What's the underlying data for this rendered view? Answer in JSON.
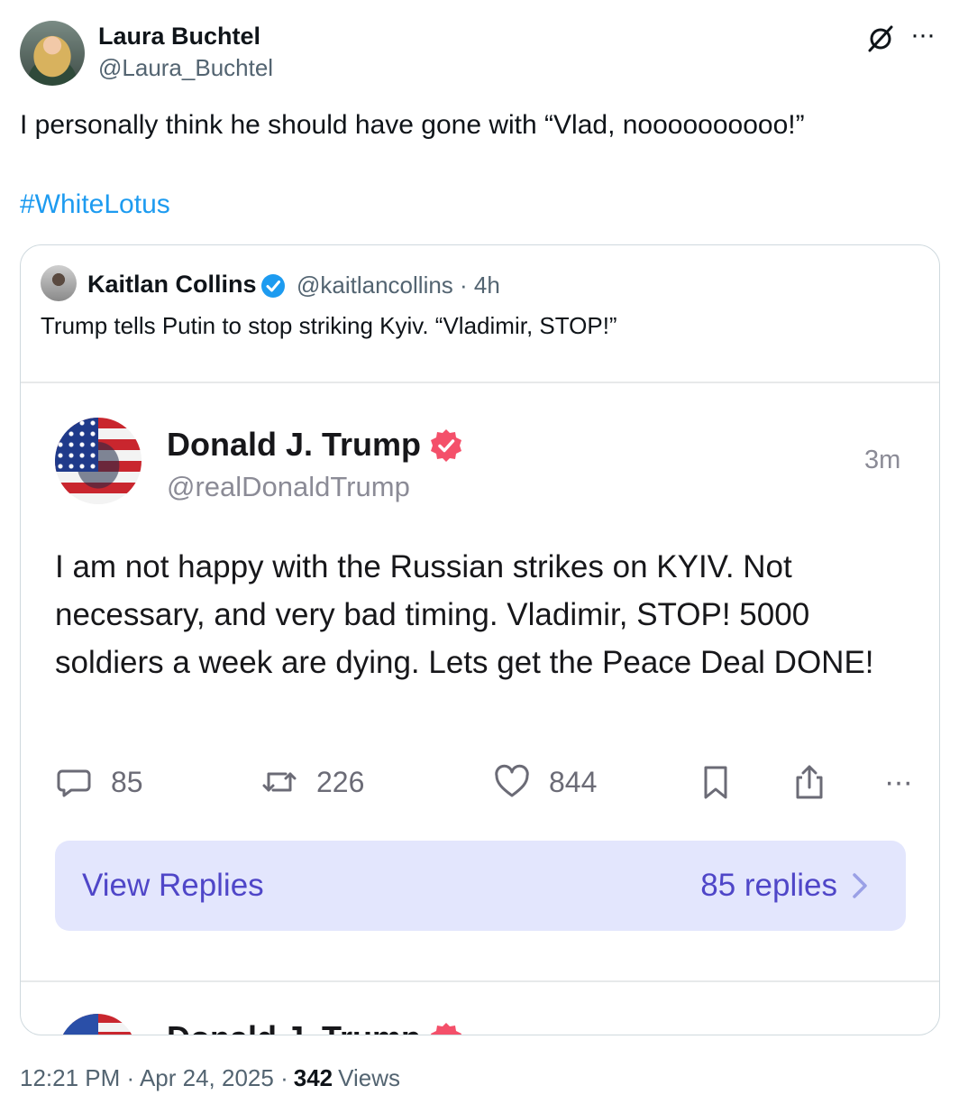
{
  "author": {
    "name": "Laura Buchtel",
    "handle": "@Laura_Buchtel"
  },
  "tweet": {
    "text": "I personally think he should have gone with “Vlad, noooooooooo!”",
    "hashtag": "#WhiteLotus"
  },
  "quoted": {
    "name": "Kaitlan Collins",
    "handle_time": "@kaitlancollins · 4h",
    "text": "Trump tells Putin to stop striking Kyiv. “Vladimir, STOP!”",
    "embedded_post": {
      "name": "Donald J. Trump",
      "handle": "@realDonaldTrump",
      "time": "3m",
      "body": "I am not happy with the Russian strikes on KYIV. Not necessary, and very bad timing. Vladimir, STOP! 5000 soldiers a week are dying. Lets get the Peace Deal DONE!",
      "replies": "85",
      "reposts": "226",
      "likes": "844",
      "view_replies_label": "View Replies",
      "view_replies_count": "85 replies",
      "next_post_name": "Donald J. Trump"
    }
  },
  "footer": {
    "timestamp": "12:21 PM · Apr 24, 2025 ·",
    "views_count": "342",
    "views_label": "Views"
  },
  "colors": {
    "link_blue": "#1d9bf0",
    "truth_verified": "#f4506a",
    "view_replies_bg": "#e3e6fd",
    "view_replies_text": "#4f46c8"
  }
}
